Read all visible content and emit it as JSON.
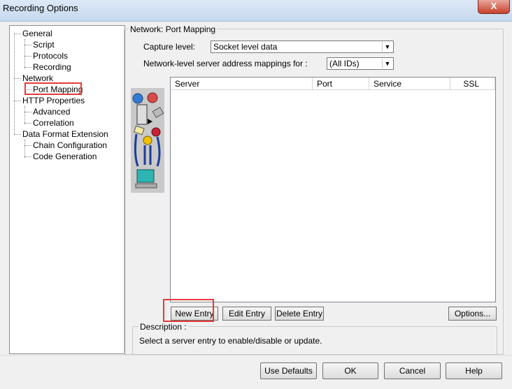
{
  "window": {
    "title": "Recording Options",
    "close_label": "X"
  },
  "tree": {
    "items": [
      {
        "label": "General"
      },
      {
        "label": "Script"
      },
      {
        "label": "Protocols"
      },
      {
        "label": "Recording"
      },
      {
        "label": "Network"
      },
      {
        "label": "Port Mapping"
      },
      {
        "label": "HTTP Properties"
      },
      {
        "label": "Advanced"
      },
      {
        "label": "Correlation"
      },
      {
        "label": "Data Format Extension"
      },
      {
        "label": "Chain Configuration"
      },
      {
        "label": "Code Generation"
      }
    ],
    "selected": "Port Mapping"
  },
  "panel": {
    "group_title": "Network: Port Mapping",
    "capture_level_label": "Capture level:",
    "capture_level_value": "Socket level data",
    "mapping_label": "Network-level server address mappings for :",
    "mapping_value": "(All IDs)",
    "columns": [
      "Server",
      "Port",
      "Service",
      "SSL"
    ],
    "rows": [],
    "buttons": {
      "new_entry": "New Entry",
      "edit_entry": "Edit Entry",
      "delete_entry": "Delete Entry",
      "options": "Options..."
    },
    "description_title": "Description :",
    "description_text": "Select a server entry to enable/disable or update."
  },
  "footer": {
    "use_defaults": "Use Defaults",
    "ok": "OK",
    "cancel": "Cancel",
    "help": "Help"
  },
  "colors": {
    "highlight_box": "#e53a3a",
    "close_button": "#c7402c"
  }
}
